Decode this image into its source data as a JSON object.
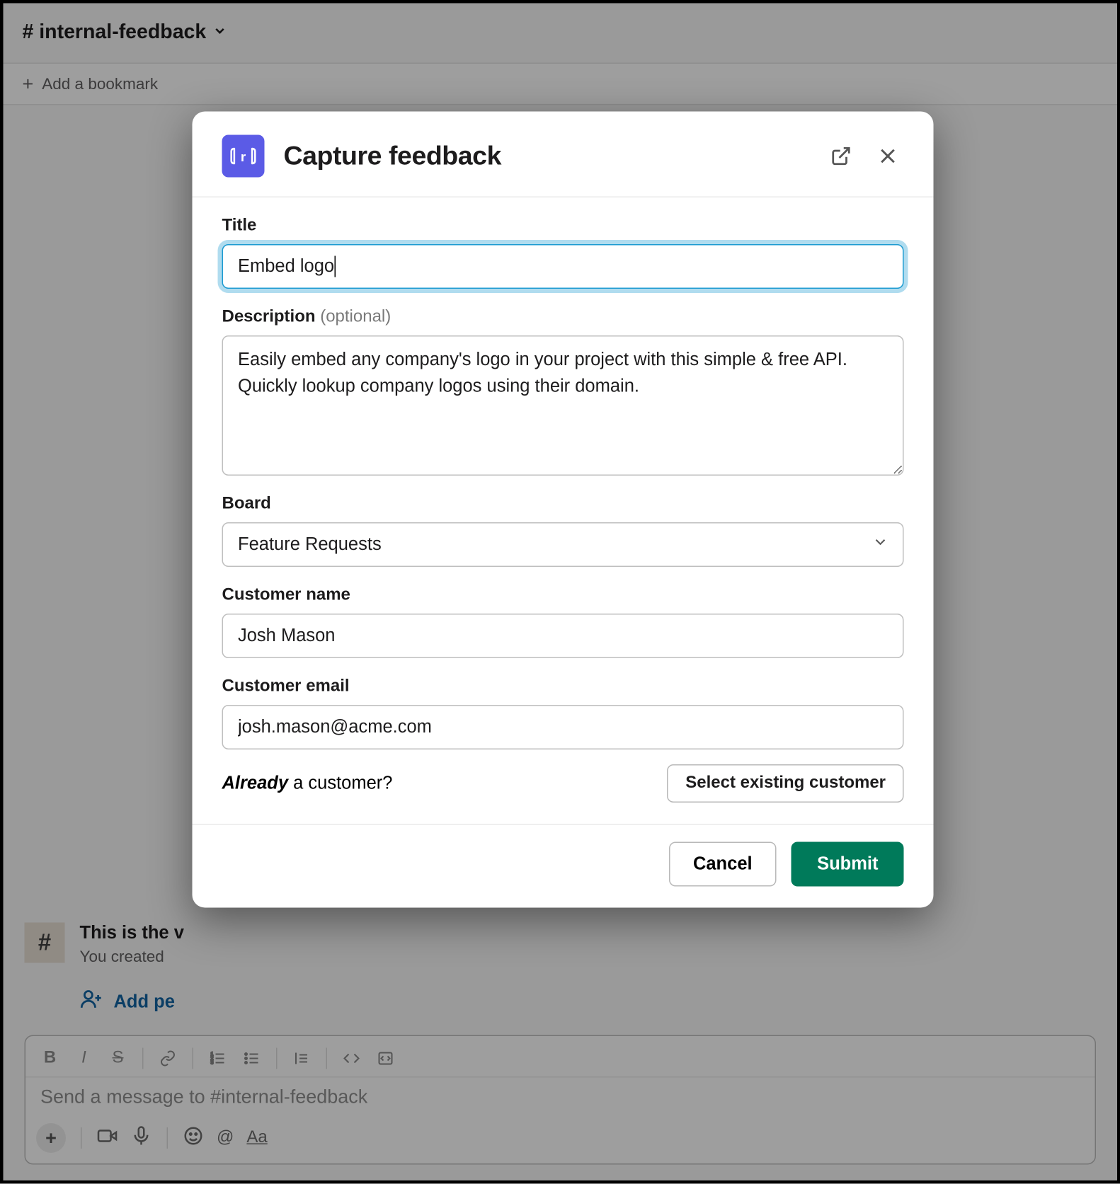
{
  "channel": {
    "name": "# internal-feedback",
    "bookmark_prompt": "Add a bookmark",
    "welcome_title": "This is the v",
    "welcome_sub": "You created",
    "add_people": "Add pe",
    "composer_placeholder": "Send a message to #internal-feedback"
  },
  "modal": {
    "title": "Capture feedback",
    "fields": {
      "title": {
        "label": "Title",
        "value": "Embed logo"
      },
      "description": {
        "label": "Description",
        "optional_suffix": "(optional)",
        "value": "Easily embed any company's logo in your project with this simple & free API. Quickly lookup company logos using their domain."
      },
      "board": {
        "label": "Board",
        "value": "Feature Requests"
      },
      "customer_name": {
        "label": "Customer name",
        "value": "Josh Mason"
      },
      "customer_email": {
        "label": "Customer email",
        "value": "josh.mason@acme.com"
      }
    },
    "already_italic": "Already",
    "already_rest": " a customer?",
    "select_existing": "Select existing customer",
    "cancel": "Cancel",
    "submit": "Submit"
  },
  "icons": {
    "app_logo": "r-logo",
    "popout": "open-externally-icon",
    "close": "close-icon"
  },
  "colors": {
    "accent_focus": "#1d9bd1",
    "submit_bg": "#007a5a",
    "app_logo_bg": "#5b5be6",
    "link_blue": "#1264a3"
  }
}
